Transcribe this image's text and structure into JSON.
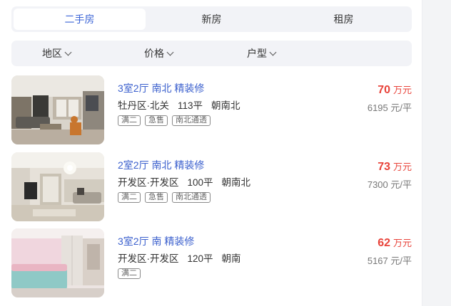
{
  "tabs": [
    {
      "label": "二手房",
      "active": true
    },
    {
      "label": "新房",
      "active": false
    },
    {
      "label": "租房",
      "active": false
    }
  ],
  "filters": [
    {
      "label": "地区"
    },
    {
      "label": "价格"
    },
    {
      "label": "户型"
    }
  ],
  "listings": [
    {
      "title": "3室2厅 南北 精装修",
      "location": "牡丹区·北关",
      "area": "113平",
      "orientation": "朝南北",
      "tags": [
        "满二",
        "急售",
        "南北通透"
      ],
      "price": "70",
      "price_unit": "万元",
      "unit_price": "6195 元/平"
    },
    {
      "title": "2室2厅 南北 精装修",
      "location": "开发区·开发区",
      "area": "100平",
      "orientation": "朝南北",
      "tags": [
        "满二",
        "急售",
        "南北通透"
      ],
      "price": "73",
      "price_unit": "万元",
      "unit_price": "7300 元/平"
    },
    {
      "title": "3室2厅 南 精装修",
      "location": "开发区·开发区",
      "area": "120平",
      "orientation": "朝南",
      "tags": [
        "满二"
      ],
      "price": "62",
      "price_unit": "万元",
      "unit_price": "5167 元/平"
    }
  ],
  "colors": {
    "accent": "#3a63d6",
    "price": "#e8433a",
    "panel_bg": "#f2f3f7"
  },
  "icons": {
    "filter_chevron": "chevron-down-icon"
  }
}
